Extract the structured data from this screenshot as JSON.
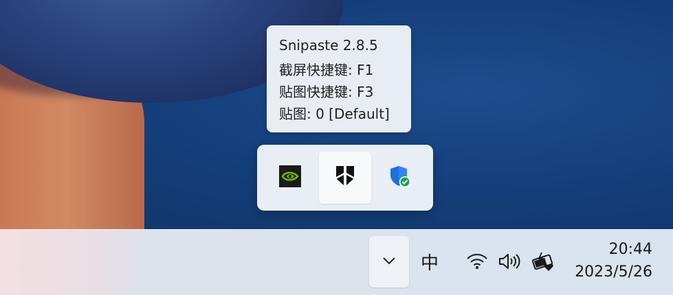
{
  "tooltip": {
    "line1": "Snipaste 2.8.5",
    "line2": "截屏快捷键: F1",
    "line3": "贴图快捷键: F3",
    "line4": "贴图: 0 [Default]"
  },
  "tray_flyout": {
    "items": [
      {
        "icon": "nvidia-icon"
      },
      {
        "icon": "snipaste-icon"
      },
      {
        "icon": "windows-security-icon"
      }
    ]
  },
  "taskbar": {
    "ime_label": "中",
    "clock_time": "20:44",
    "clock_date": "2023/5/26"
  },
  "colors": {
    "nvidia_green": "#76b900",
    "security_blue": "#1e6fd9",
    "check_green": "#16a34a"
  }
}
